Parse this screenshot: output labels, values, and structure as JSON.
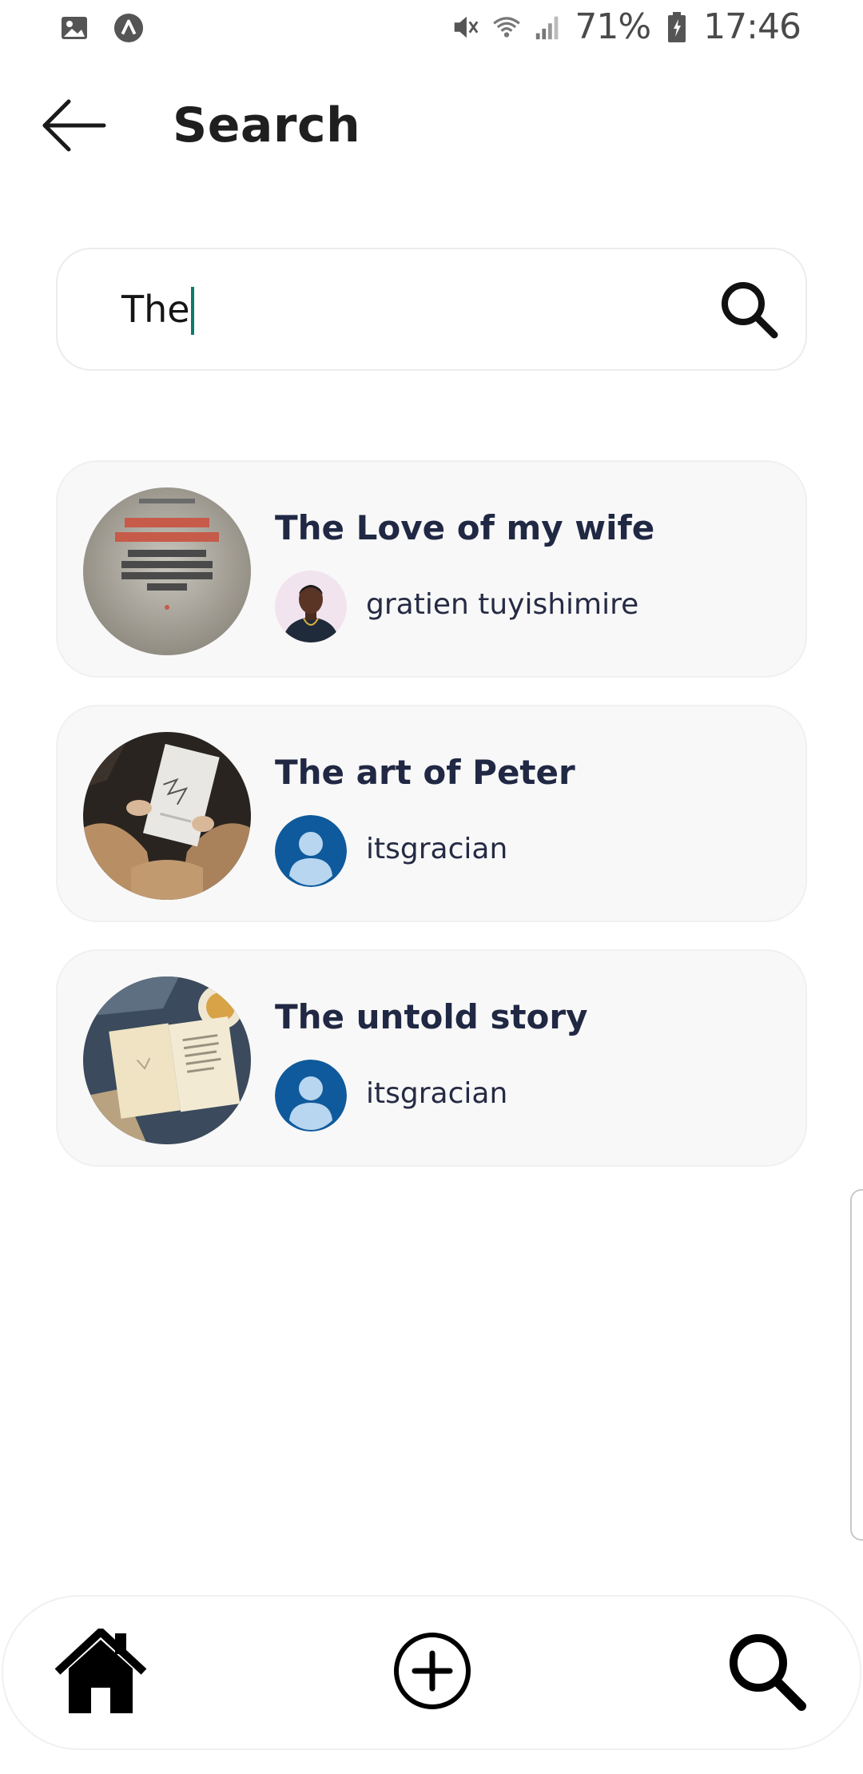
{
  "status_bar": {
    "battery": "71%",
    "time": "17:46",
    "icons": [
      "gallery-icon",
      "app-notification-icon",
      "mute-icon",
      "wifi-icon",
      "signal-icon",
      "battery-icon"
    ]
  },
  "header": {
    "title": "Search",
    "back_icon": "arrow-left-icon"
  },
  "search": {
    "value": "The",
    "icon": "search-icon"
  },
  "results": [
    {
      "title": "The Love of my wife",
      "author": "gratien tuyishimire",
      "cover": "soviet-book-cover",
      "avatar": "user-photo"
    },
    {
      "title": "The art of Peter",
      "author": "itsgracian",
      "cover": "hands-holding-book",
      "avatar": "default-avatar-icon"
    },
    {
      "title": "The untold story",
      "author": "itsgracian",
      "cover": "open-book-on-table",
      "avatar": "default-avatar-icon"
    }
  ],
  "bottom_nav": {
    "items": [
      "home-icon",
      "add-circle-icon",
      "search-icon"
    ]
  },
  "colors": {
    "accent_caret": "#0d7a6a",
    "title_text": "#202844",
    "avatar_blue": "#0f5a9c",
    "card_bg": "#f8f8f8"
  }
}
